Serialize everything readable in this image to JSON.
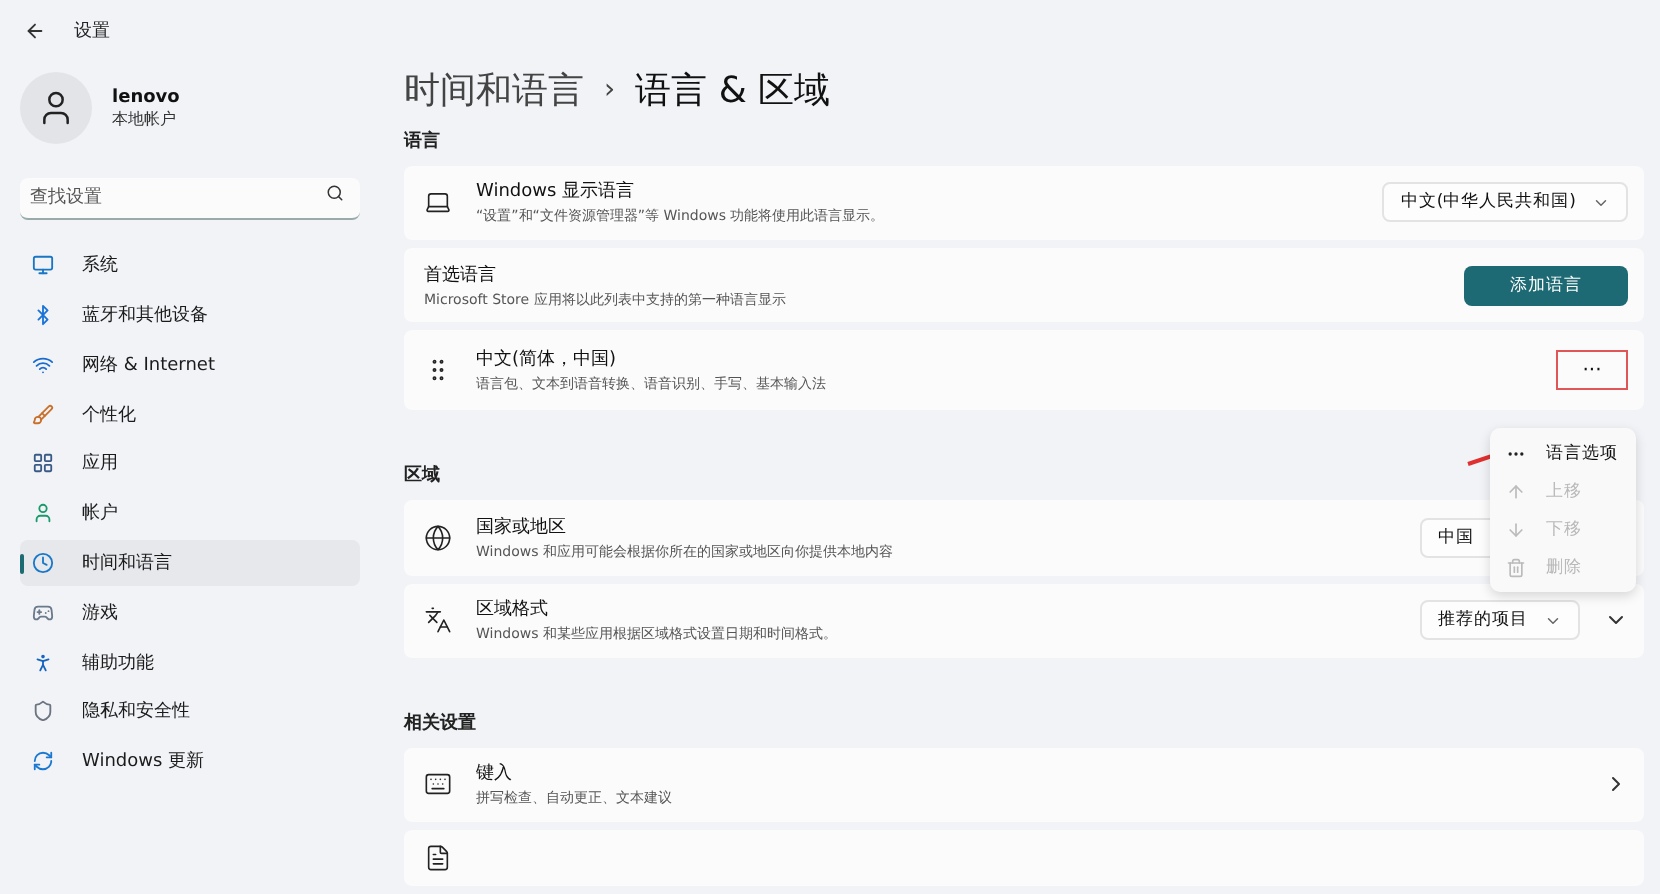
{
  "window": {
    "title": "设置"
  },
  "account": {
    "name": "lenovo",
    "type": "本地帐户"
  },
  "search": {
    "placeholder": "查找设置"
  },
  "sidebar": {
    "items": [
      {
        "label": "系统",
        "selected": false
      },
      {
        "label": "蓝牙和其他设备",
        "selected": false
      },
      {
        "label": "网络 & Internet",
        "selected": false
      },
      {
        "label": "个性化",
        "selected": false
      },
      {
        "label": "应用",
        "selected": false
      },
      {
        "label": "帐户",
        "selected": false
      },
      {
        "label": "时间和语言",
        "selected": true
      },
      {
        "label": "游戏",
        "selected": false
      },
      {
        "label": "辅助功能",
        "selected": false
      },
      {
        "label": "隐私和安全性",
        "selected": false
      },
      {
        "label": "Windows 更新",
        "selected": false
      }
    ]
  },
  "breadcrumb": {
    "parent": "时间和语言",
    "separator": "›",
    "current": "语言 & 区域"
  },
  "sections": [
    {
      "title": "语言",
      "rows": [
        {
          "kind": "dropdown",
          "title": "Windows 显示语言",
          "description": "“设置”和“文件资源管理器”等 Windows 功能将使用此语言显示。",
          "value": "中文(中华人民共和国)"
        },
        {
          "kind": "button",
          "title": "首选语言",
          "description": "Microsoft Store 应用将以此列表中支持的第一种语言显示",
          "button": "添加语言"
        },
        {
          "kind": "language",
          "title": "中文(简体，中国)",
          "description": "语言包、文本到语音转换、语音识别、手写、基本输入法",
          "more": "···",
          "highlighted": true
        }
      ]
    },
    {
      "title": "区域",
      "rows": [
        {
          "kind": "dropdown",
          "title": "国家或地区",
          "description": "Windows 和应用可能会根据你所在的国家或地区向你提供本地内容",
          "value": "中国"
        },
        {
          "kind": "expand",
          "title": "区域格式",
          "description": "Windows 和某些应用根据区域格式设置日期和时间格式。",
          "value": "推荐的项目"
        }
      ]
    },
    {
      "title": "相关设置",
      "rows": [
        {
          "kind": "link",
          "title": "键入",
          "description": "拼写检查、自动更正、文本建议"
        },
        {
          "kind": "peek"
        }
      ]
    }
  ],
  "context_menu": {
    "items": [
      {
        "label": "语言选项",
        "disabled": false
      },
      {
        "label": "上移",
        "disabled": true
      },
      {
        "label": "下移",
        "disabled": true
      },
      {
        "label": "删除",
        "disabled": true
      }
    ]
  }
}
